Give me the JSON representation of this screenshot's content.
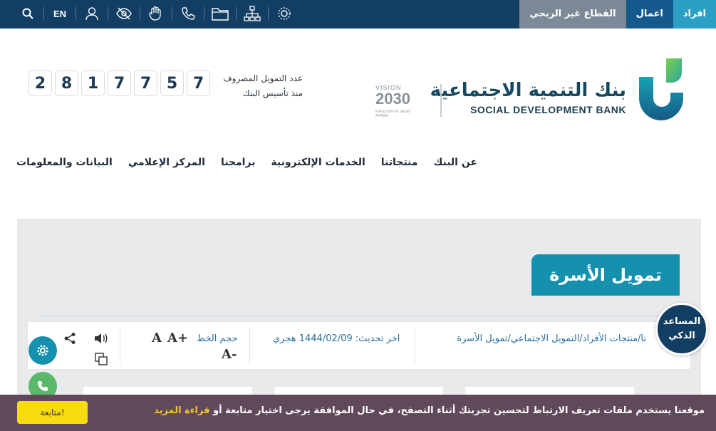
{
  "topbar": {
    "tabs": [
      {
        "label": "افراد"
      },
      {
        "label": "اعمال"
      },
      {
        "label": "القطاع غير الربحي"
      }
    ],
    "lang_label": "EN",
    "icons": [
      "search-icon",
      "user-icon",
      "eye-slash-icon",
      "sign-language-icon",
      "phone-icon",
      "folder-icon",
      "sitemap-icon",
      "gear-badge-icon"
    ]
  },
  "brand": {
    "name_ar": "بنك التنمية الاجتماعية",
    "name_en": "SOCIAL DEVELOPMENT BANK",
    "vision_top": "VISION",
    "vision_year": "2030",
    "vision_sub": "KINGDOM OF SAUDI ARABIA"
  },
  "counter": {
    "label_line1": "عدد التمويل المصروف",
    "label_line2": "منذ تأسيس البنك",
    "digits": [
      "2",
      "8",
      "1",
      "7",
      "7",
      "5",
      "7"
    ]
  },
  "nav": {
    "items": [
      {
        "label": "عن البنك"
      },
      {
        "label": "منتجاتنا"
      },
      {
        "label": "الخدمات الإلكترونية"
      },
      {
        "label": "برامجنا"
      },
      {
        "label": "المركز الإعلامي"
      },
      {
        "label": "البيانات والمعلومات"
      }
    ]
  },
  "page": {
    "title": "تمويل الأسرة",
    "breadcrumb": "نا/منتجات الأفراد/التمويل الاجتماعي/تمويل الأسرة",
    "updated": "اخر تحديث: 1444/02/09 هجري",
    "font_size_label": "حجم الخط",
    "font_increase": "A+",
    "font_default": "A",
    "font_decrease": "A-"
  },
  "assistant": {
    "line1": "المساعد",
    "line2": "الذكي"
  },
  "cookie": {
    "text": "موقعنا يستخدم ملفات تعريف الارتباط لتحسين تجربتك أثناء التصفح، في حال الموافقة يرجى اختيار متابعة أو ",
    "more_link": "قراءة المزيد",
    "continue_button": "متابعة!"
  }
}
